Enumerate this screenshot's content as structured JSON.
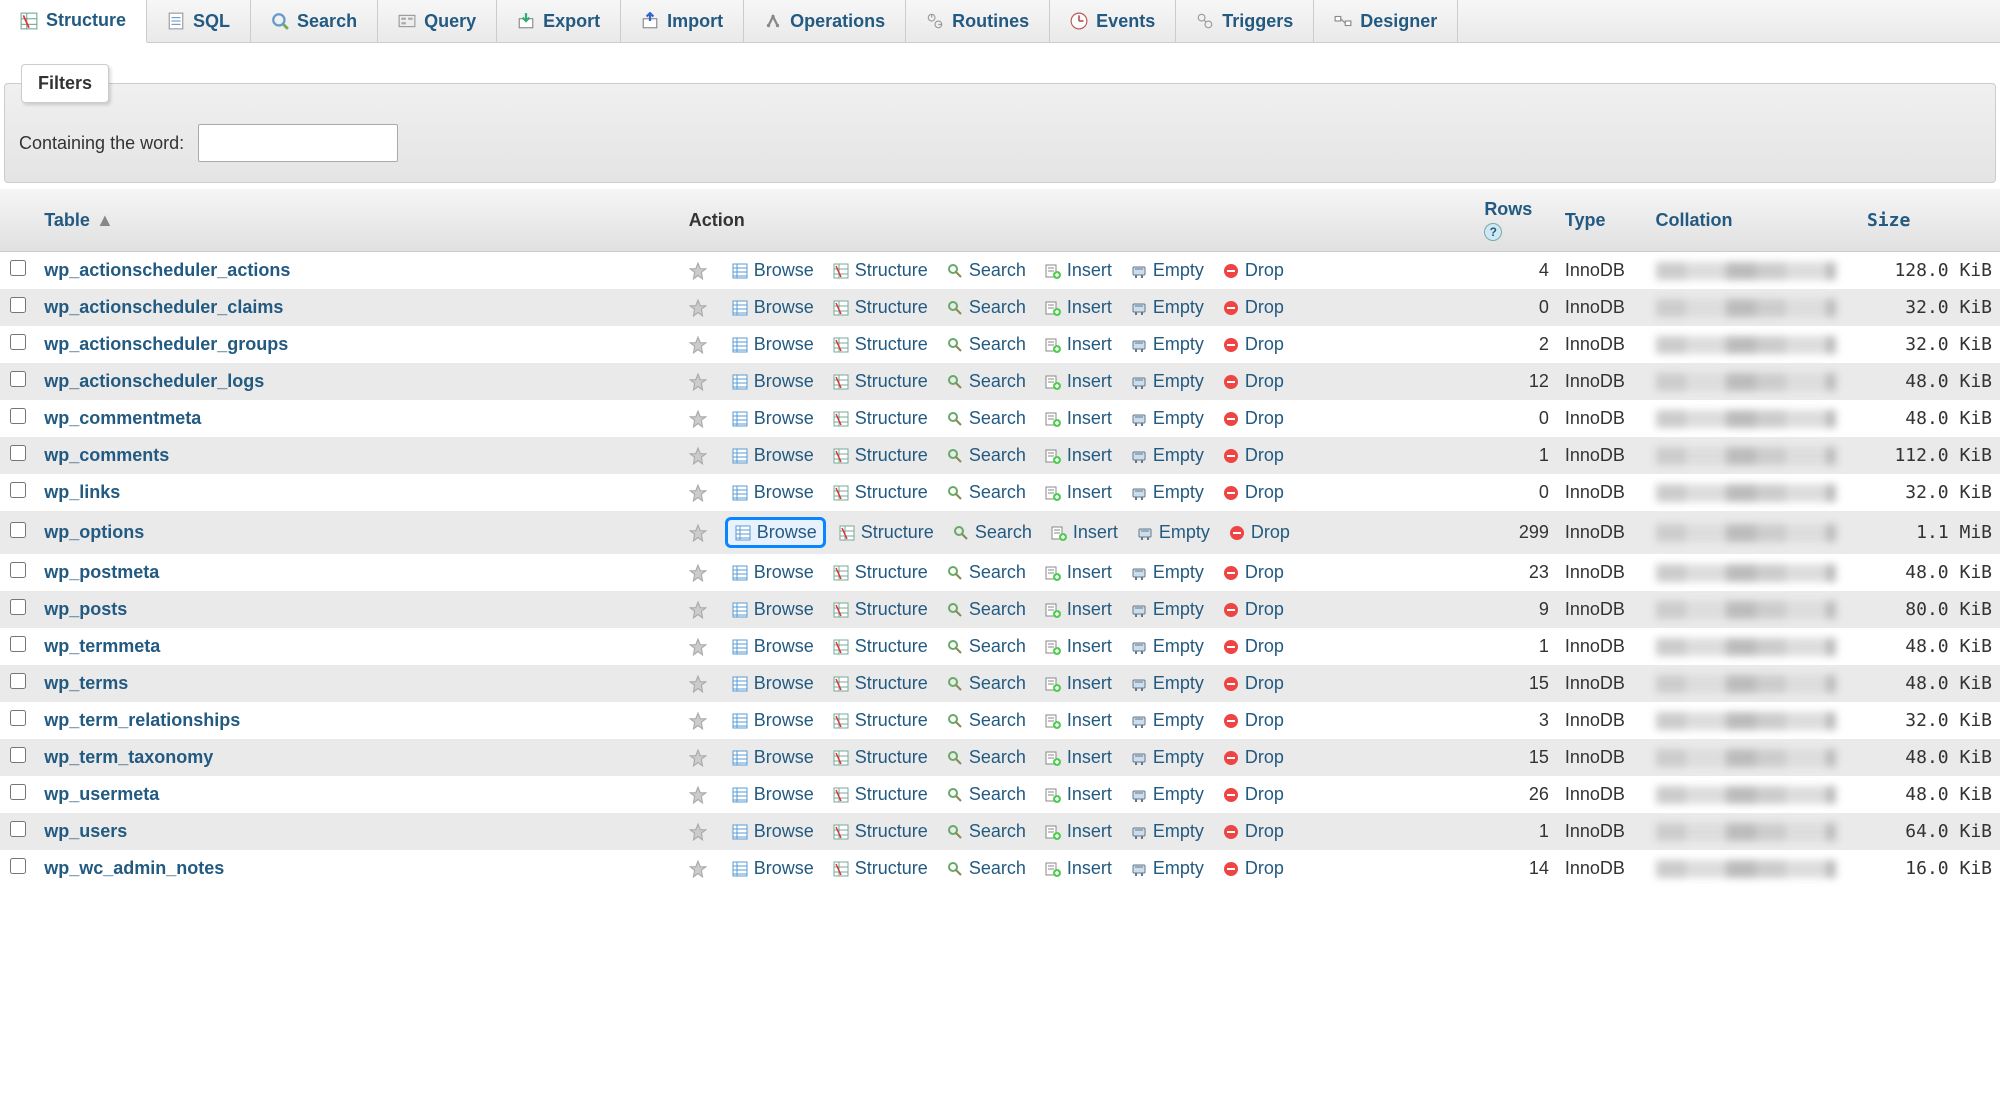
{
  "topTabs": [
    {
      "id": "structure",
      "label": "Structure",
      "active": true
    },
    {
      "id": "sql",
      "label": "SQL",
      "active": false
    },
    {
      "id": "search",
      "label": "Search",
      "active": false
    },
    {
      "id": "query",
      "label": "Query",
      "active": false
    },
    {
      "id": "export",
      "label": "Export",
      "active": false
    },
    {
      "id": "import",
      "label": "Import",
      "active": false
    },
    {
      "id": "operations",
      "label": "Operations",
      "active": false
    },
    {
      "id": "routines",
      "label": "Routines",
      "active": false
    },
    {
      "id": "events",
      "label": "Events",
      "active": false
    },
    {
      "id": "triggers",
      "label": "Triggers",
      "active": false
    },
    {
      "id": "designer",
      "label": "Designer",
      "active": false
    }
  ],
  "filters": {
    "tabLabel": "Filters",
    "containingLabel": "Containing the word:",
    "containingValue": ""
  },
  "columns": {
    "table": "Table",
    "action": "Action",
    "rows": "Rows",
    "type": "Type",
    "collation": "Collation",
    "size": "Size"
  },
  "actionsLabels": {
    "browse": "Browse",
    "structure": "Structure",
    "search": "Search",
    "insert": "Insert",
    "empty": "Empty",
    "drop": "Drop"
  },
  "tables": [
    {
      "name": "wp_actionscheduler_actions",
      "rows": "4",
      "type": "InnoDB",
      "size": "128.0 KiB",
      "highlight": false
    },
    {
      "name": "wp_actionscheduler_claims",
      "rows": "0",
      "type": "InnoDB",
      "size": "32.0 KiB",
      "highlight": false
    },
    {
      "name": "wp_actionscheduler_groups",
      "rows": "2",
      "type": "InnoDB",
      "size": "32.0 KiB",
      "highlight": false
    },
    {
      "name": "wp_actionscheduler_logs",
      "rows": "12",
      "type": "InnoDB",
      "size": "48.0 KiB",
      "highlight": false
    },
    {
      "name": "wp_commentmeta",
      "rows": "0",
      "type": "InnoDB",
      "size": "48.0 KiB",
      "highlight": false
    },
    {
      "name": "wp_comments",
      "rows": "1",
      "type": "InnoDB",
      "size": "112.0 KiB",
      "highlight": false
    },
    {
      "name": "wp_links",
      "rows": "0",
      "type": "InnoDB",
      "size": "32.0 KiB",
      "highlight": false
    },
    {
      "name": "wp_options",
      "rows": "299",
      "type": "InnoDB",
      "size": "1.1 MiB",
      "highlight": true
    },
    {
      "name": "wp_postmeta",
      "rows": "23",
      "type": "InnoDB",
      "size": "48.0 KiB",
      "highlight": false
    },
    {
      "name": "wp_posts",
      "rows": "9",
      "type": "InnoDB",
      "size": "80.0 KiB",
      "highlight": false
    },
    {
      "name": "wp_termmeta",
      "rows": "1",
      "type": "InnoDB",
      "size": "48.0 KiB",
      "highlight": false
    },
    {
      "name": "wp_terms",
      "rows": "15",
      "type": "InnoDB",
      "size": "48.0 KiB",
      "highlight": false
    },
    {
      "name": "wp_term_relationships",
      "rows": "3",
      "type": "InnoDB",
      "size": "32.0 KiB",
      "highlight": false
    },
    {
      "name": "wp_term_taxonomy",
      "rows": "15",
      "type": "InnoDB",
      "size": "48.0 KiB",
      "highlight": false
    },
    {
      "name": "wp_usermeta",
      "rows": "26",
      "type": "InnoDB",
      "size": "48.0 KiB",
      "highlight": false
    },
    {
      "name": "wp_users",
      "rows": "1",
      "type": "InnoDB",
      "size": "64.0 KiB",
      "highlight": false
    },
    {
      "name": "wp_wc_admin_notes",
      "rows": "14",
      "type": "InnoDB",
      "size": "16.0 KiB",
      "highlight": false
    }
  ]
}
